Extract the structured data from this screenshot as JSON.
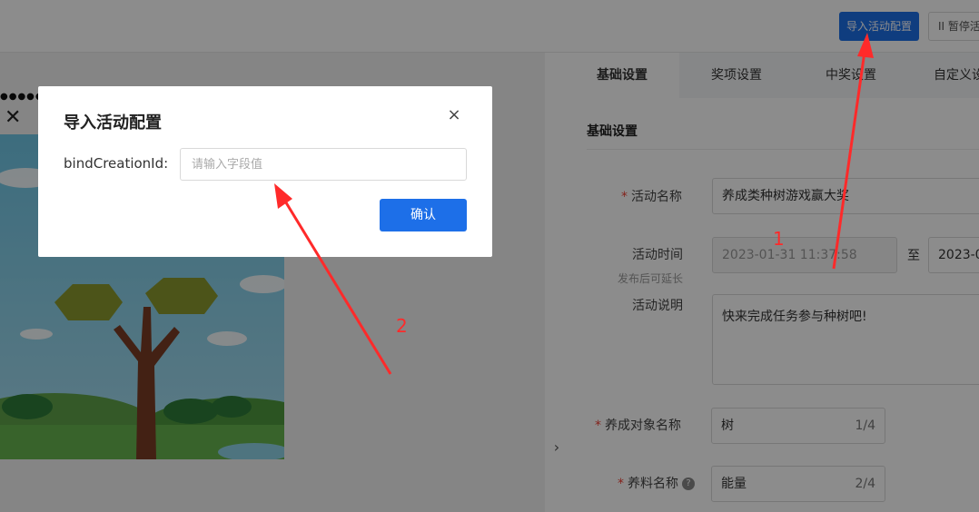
{
  "toolbar": {
    "import_label": "导入活动配置",
    "pause_label": "II 暂停活"
  },
  "preview": {
    "status_text": "●●●●●● 中",
    "close_glyph": "✕",
    "arrow_glyph": "›"
  },
  "tabs": [
    {
      "label": "基础设置"
    },
    {
      "label": "奖项设置"
    },
    {
      "label": "中奖设置"
    },
    {
      "label": "自定义设"
    }
  ],
  "form": {
    "section_title": "基础设置",
    "activity_name": {
      "label": "活动名称",
      "value": "养成类种树游戏赢大奖"
    },
    "activity_time": {
      "label": "活动时间",
      "hint": "发布后可延长",
      "start": "2023-01-31 11:37:58",
      "separator": "至",
      "end": "2023-0"
    },
    "activity_desc": {
      "label": "活动说明",
      "value": "快来完成任务参与种树吧!"
    },
    "target_name": {
      "label": "养成对象名称",
      "value": "树",
      "count": "1/4"
    },
    "feed_name": {
      "label": "养料名称",
      "value": "能量",
      "count": "2/4",
      "help": "?"
    }
  },
  "modal": {
    "title": "导入活动配置",
    "close_glyph": "×",
    "field_label": "bindCreationId:",
    "field_placeholder": "请输入字段值",
    "field_value": "",
    "confirm_label": "确认"
  },
  "annotations": {
    "num1": "1",
    "num2": "2",
    "color": "#ff2a2a"
  },
  "colors": {
    "primary": "#1d6fe8",
    "required": "#f04134"
  }
}
